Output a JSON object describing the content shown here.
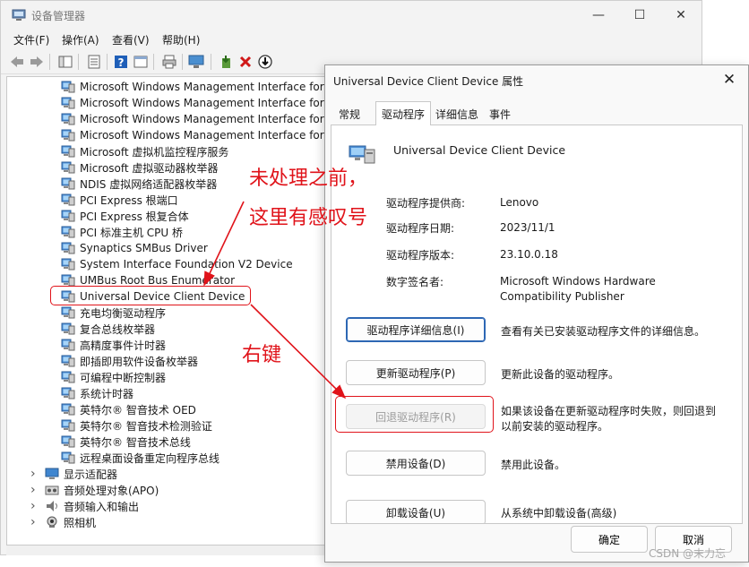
{
  "window": {
    "title": "设备管理器",
    "menu": [
      "文件(F)",
      "操作(A)",
      "查看(V)",
      "帮助(H)"
    ],
    "controls": {
      "minimize": "—",
      "maximize": "☐",
      "close": "✕"
    }
  },
  "tree": {
    "device_rows": [
      "Microsoft Windows Management Interface for",
      "Microsoft Windows Management Interface for",
      "Microsoft Windows Management Interface for",
      "Microsoft Windows Management Interface for",
      "Microsoft 虚拟机监控程序服务",
      "Microsoft 虚拟驱动器枚举器",
      "NDIS 虚拟网络适配器枚举器",
      "PCI Express 根端口",
      "PCI Express 根复合体",
      "PCI 标准主机 CPU 桥",
      "Synaptics SMBus Driver",
      "System Interface Foundation V2 Device",
      "UMBus Root Bus Enumerator",
      "Universal Device Client Device",
      "充电均衡驱动程序",
      "复合总线枚举器",
      "高精度事件计时器",
      "即插即用软件设备枚举器",
      "可编程中断控制器",
      "系统计时器",
      "英特尔® 智音技术 OED",
      "英特尔® 智音技术检测验证",
      "英特尔® 智音技术总线",
      "远程桌面设备重定向程序总线"
    ],
    "categories": [
      "显示适配器",
      "音频处理对象(APO)",
      "音频输入和输出",
      "照相机"
    ],
    "expander_glyph": "›"
  },
  "dialog": {
    "title": "Universal Device Client Device 属性",
    "close": "✕",
    "tabs": [
      "常规",
      "驱动程序",
      "详细信息",
      "事件"
    ],
    "device_name": "Universal Device Client Device",
    "properties": [
      {
        "label": "驱动程序提供商:",
        "value": "Lenovo"
      },
      {
        "label": "驱动程序日期:",
        "value": "2023/11/1"
      },
      {
        "label": "驱动程序版本:",
        "value": "23.10.0.18"
      },
      {
        "label": "数字签名者:",
        "value": "Microsoft Windows Hardware Compatibility Publisher"
      }
    ],
    "actions": [
      {
        "label": "驱动程序详细信息(I)",
        "desc": "查看有关已安装驱动程序文件的详细信息。"
      },
      {
        "label": "更新驱动程序(P)",
        "desc": "更新此设备的驱动程序。"
      },
      {
        "label": "回退驱动程序(R)",
        "desc": "如果该设备在更新驱动程序时失败，则回退到以前安装的驱动程序。"
      },
      {
        "label": "禁用设备(D)",
        "desc": "禁用此设备。"
      },
      {
        "label": "卸载设备(U)",
        "desc": "从系统中卸载设备(高级)"
      }
    ],
    "ok": "确定",
    "cancel": "取消"
  },
  "annotations": {
    "note_line1": "未处理之前，",
    "note_line2": "这里有感叹号",
    "right_click": "右键",
    "color": "#e0131a"
  },
  "watermark": "CSDN @末力忘"
}
